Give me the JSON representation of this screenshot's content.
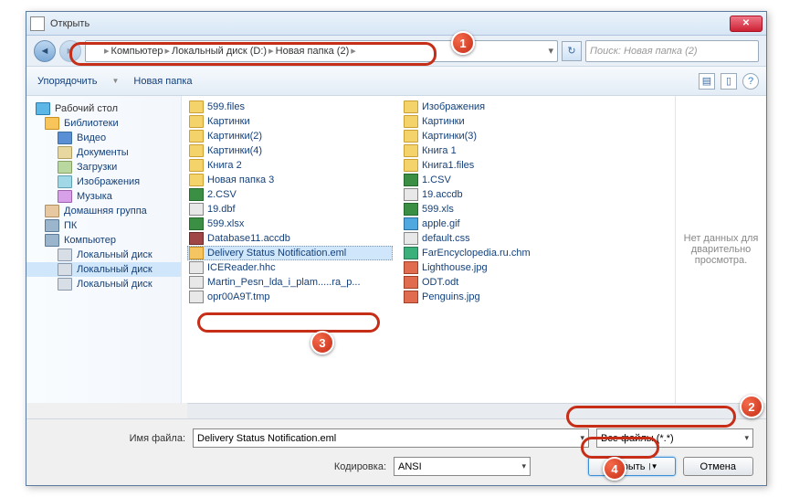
{
  "title": "Открыть",
  "breadcrumb": [
    "Компьютер",
    "Локальный диск (D:)",
    "Новая папка (2)"
  ],
  "search_placeholder": "Поиск: Новая папка (2)",
  "toolbar": {
    "organize": "Упорядочить",
    "newfolder": "Новая папка"
  },
  "nav": {
    "desktop": "Рабочий стол",
    "libraries": "Библиотеки",
    "video": "Видео",
    "documents": "Документы",
    "downloads": "Загрузки",
    "images": "Изображения",
    "music": "Музыка",
    "homegroup": "Домашняя группа",
    "pc": "ПК",
    "computer": "Компьютер",
    "disk1": "Локальный диск",
    "disk2": "Локальный диск",
    "disk3": "Локальный диск"
  },
  "files_col1": [
    {
      "n": "599.files",
      "t": "folder"
    },
    {
      "n": "Картинки",
      "t": "folder"
    },
    {
      "n": "Картинки(2)",
      "t": "folder"
    },
    {
      "n": "Картинки(4)",
      "t": "folder"
    },
    {
      "n": "Книга 2",
      "t": "folder"
    },
    {
      "n": "Новая папка 3",
      "t": "folder"
    },
    {
      "n": "2.CSV",
      "t": "xls"
    },
    {
      "n": "19.dbf",
      "t": "dbf"
    },
    {
      "n": "599.xlsx",
      "t": "xls"
    },
    {
      "n": "Database11.accdb",
      "t": "accdb"
    },
    {
      "n": "Delivery Status Notification.eml",
      "t": "eml",
      "sel": true
    },
    {
      "n": "ICEReader.hhc",
      "t": "hhc"
    },
    {
      "n": "Martin_Pesn_lda_i_plam.....ra_p...",
      "t": "dbf"
    },
    {
      "n": "opr00A9T.tmp",
      "t": "tmp"
    }
  ],
  "files_col2": [
    {
      "n": "Изображения",
      "t": "folder"
    },
    {
      "n": "Картинки",
      "t": "folder"
    },
    {
      "n": "Картинки(3)",
      "t": "folder"
    },
    {
      "n": "Книга 1",
      "t": "folder"
    },
    {
      "n": "Книга1.files",
      "t": "folder"
    },
    {
      "n": "1.CSV",
      "t": "xls"
    },
    {
      "n": "19.accdb",
      "t": "dbf"
    },
    {
      "n": "599.xls",
      "t": "xls"
    },
    {
      "n": "apple.gif",
      "t": "gif"
    },
    {
      "n": "default.css",
      "t": "css"
    },
    {
      "n": "FarEncyclopedia.ru.chm",
      "t": "chm"
    },
    {
      "n": "Lighthouse.jpg",
      "t": "jpg"
    },
    {
      "n": "ODT.odt",
      "t": "odt"
    },
    {
      "n": "Penguins.jpg",
      "t": "jpg"
    }
  ],
  "preview_text": "Нет данных для дварительно просмотра.",
  "footer": {
    "filename_label": "Имя файла:",
    "filename_value": "Delivery Status Notification.eml",
    "filter_value": "Все файлы  (*.*)",
    "encoding_label": "Кодировка:",
    "encoding_value": "ANSI",
    "open": "Открыть",
    "cancel": "Отмена"
  },
  "callouts": {
    "1": "1",
    "2": "2",
    "3": "3",
    "4": "4"
  }
}
